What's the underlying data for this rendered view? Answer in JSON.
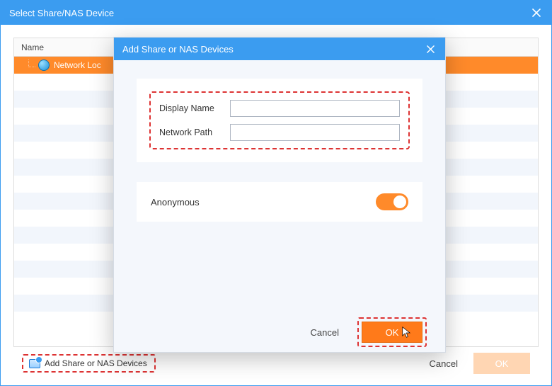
{
  "main": {
    "title": "Select Share/NAS Device",
    "table": {
      "header": "Name",
      "rows": [
        {
          "label": "Network Loc",
          "selected": true
        }
      ]
    },
    "footer": {
      "add_label": "Add Share or NAS Devices",
      "cancel_label": "Cancel",
      "ok_label": "OK"
    }
  },
  "modal": {
    "title": "Add Share or NAS Devices",
    "fields": {
      "display_name_label": "Display Name",
      "display_name_value": "",
      "network_path_label": "Network Path",
      "network_path_value": ""
    },
    "anonymous": {
      "label": "Anonymous",
      "on": true
    },
    "buttons": {
      "cancel_label": "Cancel",
      "ok_label": "OK"
    }
  }
}
